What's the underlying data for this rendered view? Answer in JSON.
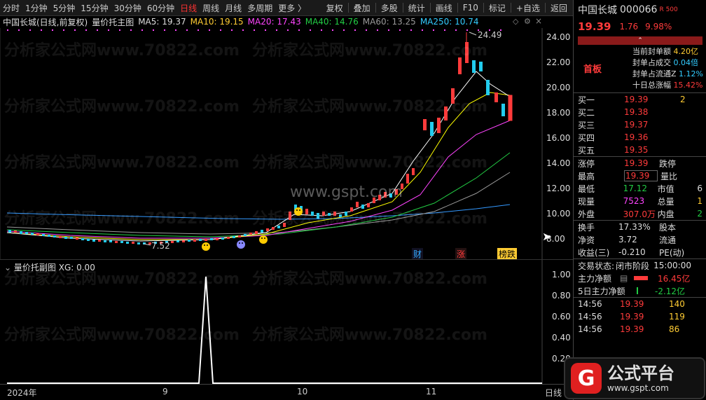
{
  "toolbar": {
    "periods": [
      "分时",
      "1分钟",
      "5分钟",
      "15分钟",
      "30分钟",
      "60分钟",
      "日线",
      "周线",
      "月线",
      "多周期",
      "更多 〉"
    ],
    "active": "日线",
    "actions": [
      "复权",
      "叠加",
      "多股",
      "统计",
      "画线",
      "F10",
      "标记",
      "+自选",
      "返回"
    ]
  },
  "legend": {
    "title": "中国长城(日线,前复权)",
    "indicator": "量价托主图",
    "ma5": "MA5: 19.37",
    "ma10": "MA10: 19.15",
    "ma20": "MA20: 17.43",
    "ma40": "MA40: 14.76",
    "ma60": "MA60: 13.25",
    "ma250": "MA250: 10.74"
  },
  "main_chart": {
    "price_labels": [
      "24.00",
      "22.00",
      "20.00",
      "18.00",
      "16.00",
      "14.00",
      "12.00",
      "10.00",
      "8.00"
    ],
    "high_label": "24.49",
    "low_label": "7.52",
    "tags": [
      "财",
      "涨",
      "榜跌"
    ],
    "watermark": "www.gspt.com"
  },
  "sub_chart": {
    "title": "量价托副图",
    "xg": "XG: 0.00",
    "levels": [
      "1.00",
      "0.80",
      "0.60",
      "0.40",
      "0.20"
    ]
  },
  "time_axis": {
    "labels": [
      "2024年",
      "9",
      "10",
      "11",
      "日线"
    ]
  },
  "watermark_text": "分析家公式网www.70822.com",
  "quote": {
    "name": "中国长城",
    "code": "000066",
    "tag": "R 500",
    "price": "19.39",
    "change": "1.76",
    "pct": "9.98%",
    "board": "首板",
    "seal_rows": [
      {
        "label": "当前封单额",
        "value": "4.20亿"
      },
      {
        "label": "封单占成交",
        "value": "0.04倍"
      },
      {
        "label": "封单占流通Z",
        "value": "1.12%"
      },
      {
        "label": "十日总涨幅",
        "value": "15.42%"
      }
    ],
    "bids": [
      {
        "label": "买一",
        "price": "19.39",
        "vol": "2"
      },
      {
        "label": "买二",
        "price": "19.38",
        "vol": ""
      },
      {
        "label": "买三",
        "price": "19.37",
        "vol": ""
      },
      {
        "label": "买四",
        "price": "19.36",
        "vol": ""
      },
      {
        "label": "买五",
        "price": "19.35",
        "vol": ""
      }
    ],
    "stats1": [
      {
        "l1": "涨停",
        "v1": "19.39",
        "l2": "跌停",
        "v2": ""
      },
      {
        "l1": "最高",
        "v1": "19.39",
        "l2": "量比",
        "v2": ""
      },
      {
        "l1": "最低",
        "v1": "17.12",
        "l2": "市值",
        "v2": "6"
      },
      {
        "l1": "现量",
        "v1": "7523",
        "l2": "总量",
        "v2": "1"
      },
      {
        "l1": "外盘",
        "v1": "307.0万",
        "l2": "内盘",
        "v2": "2"
      }
    ],
    "stats2": [
      {
        "l1": "换手",
        "v1": "17.33%",
        "l2": "股本",
        "v2": ""
      },
      {
        "l1": "净资",
        "v1": "3.72",
        "l2": "流通",
        "v2": ""
      },
      {
        "l1": "收益(三)",
        "v1": "-0.210",
        "l2": "PE(动)",
        "v2": ""
      }
    ],
    "status_label": "交易状态:",
    "status_value": "闭市阶段",
    "status_time": "15:00:00",
    "main_net_label": "主力净额",
    "main_net_value": "16.45亿",
    "five_day_label": "5日主力净额",
    "five_day_value": "-2.12亿",
    "ticks": [
      {
        "time": "14:56",
        "price": "19.39",
        "vol": "140"
      },
      {
        "time": "14:56",
        "price": "19.39",
        "vol": "119"
      },
      {
        "time": "14:56",
        "price": "19.39",
        "vol": "86"
      }
    ]
  },
  "brand": {
    "name": "公式平台",
    "url": "www.gspt.com"
  },
  "colors": {
    "up": "#ff3b3b",
    "down": "#22ccee",
    "ma5": "#ffffff",
    "ma10": "#ffff00",
    "ma20": "#ff44ff",
    "ma40": "#22cc44",
    "ma60": "#999999",
    "ma250": "#3399ff"
  }
}
